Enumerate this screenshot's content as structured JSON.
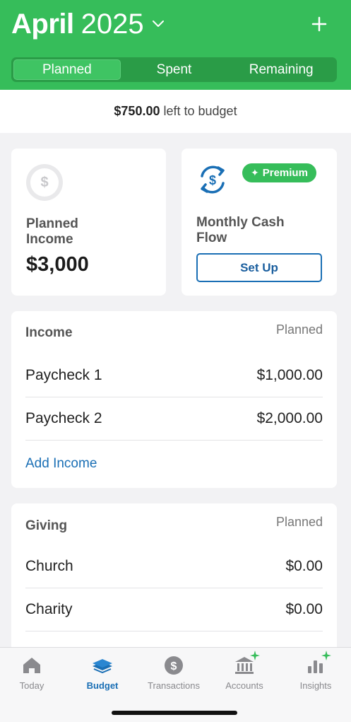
{
  "header": {
    "month": "April",
    "year": "2025",
    "tabs": [
      {
        "label": "Planned",
        "active": true
      },
      {
        "label": "Spent",
        "active": false
      },
      {
        "label": "Remaining",
        "active": false
      }
    ]
  },
  "banner": {
    "amount": "$750.00",
    "text": "left to budget"
  },
  "planned_income": {
    "label": "Planned Income",
    "amount": "$3,000"
  },
  "cash_flow": {
    "badge": "Premium",
    "label": "Monthly Cash Flow",
    "button": "Set Up"
  },
  "income_section": {
    "title": "Income",
    "column": "Planned",
    "rows": [
      {
        "name": "Paycheck 1",
        "amount": "$1,000.00"
      },
      {
        "name": "Paycheck 2",
        "amount": "$2,000.00"
      }
    ],
    "add_label": "Add Income"
  },
  "giving_section": {
    "title": "Giving",
    "column": "Planned",
    "rows": [
      {
        "name": "Church",
        "amount": "$0.00"
      },
      {
        "name": "Charity",
        "amount": "$0.00"
      }
    ]
  },
  "tabbar": [
    {
      "label": "Today",
      "icon": "home-icon"
    },
    {
      "label": "Budget",
      "icon": "budget-icon",
      "active": true
    },
    {
      "label": "Transactions",
      "icon": "dollar-icon"
    },
    {
      "label": "Accounts",
      "icon": "bank-icon"
    },
    {
      "label": "Insights",
      "icon": "chart-icon"
    }
  ],
  "colors": {
    "brand_green": "#36bd5a",
    "link_blue": "#1a6fb5"
  }
}
